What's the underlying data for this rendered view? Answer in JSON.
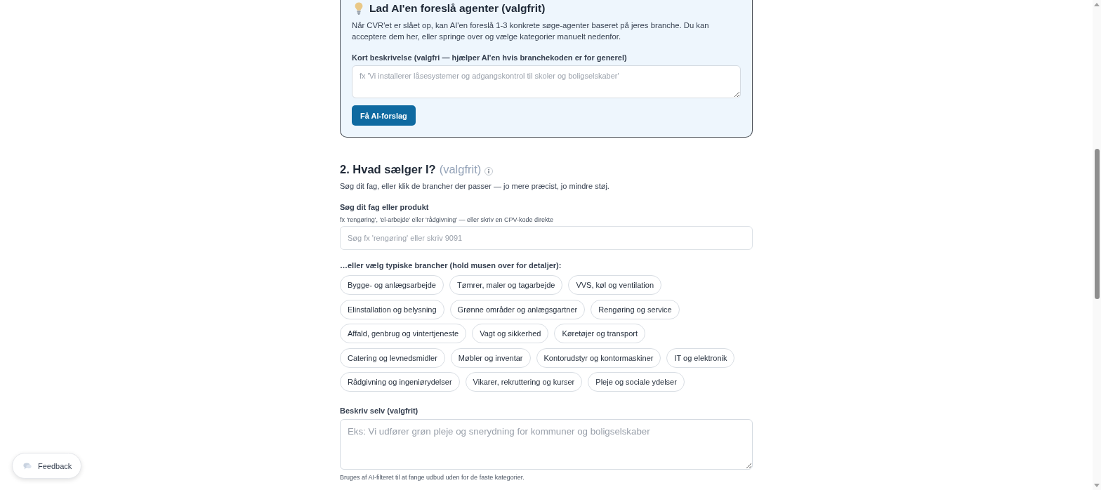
{
  "ai_card": {
    "title": "Lad AI'en foreslå agenter (valgfrit)",
    "description": "Når CVR'et er slået op, kan AI'en foreslå 1-3 konkrete søge-agenter baseret på jeres branche. Du kan acceptere dem her, eller springe over og vælge kategorier manuelt nedenfor.",
    "field": {
      "label": "Kort beskrivelse (valgfri — hjælper AI'en hvis branchekoden er for generel)",
      "placeholder": "fx 'Vi installerer låsesystemer og adgangskontrol til skoler og boligselskaber'"
    },
    "button": "Få AI-forslag"
  },
  "section": {
    "title": "2. Hvad sælger I?",
    "optional": "(valgfrit)",
    "subtitle": "Søg dit fag, eller klik de brancher der passer — jo mere præcist, jo mindre støj.",
    "search": {
      "label": "Søg dit fag eller produkt",
      "hint": "fx 'rengøring', 'el-arbejde' eller 'rådgivning' — eller skriv en CPV-kode direkte",
      "placeholder": "Søg fx 'rengøring' eller skriv 9091"
    },
    "chips_label": "…eller vælg typiske brancher (hold musen over for detaljer):",
    "chips": [
      {
        "label": "Bygge- og anlægsarbejde",
        "selected": false
      },
      {
        "label": "Tømrer, maler og tagarbejde",
        "selected": false
      },
      {
        "label": "VVS, køl og ventilation",
        "selected": false
      },
      {
        "label": "Elinstallation og belysning",
        "selected": false
      },
      {
        "label": "Grønne områder og anlægsgartner",
        "selected": false
      },
      {
        "label": "Rengøring og service",
        "selected": false
      },
      {
        "label": "Affald, genbrug og vintertjeneste",
        "selected": false
      },
      {
        "label": "Vagt og sikkerhed",
        "selected": false
      },
      {
        "label": "Køretøjer og transport",
        "selected": false
      },
      {
        "label": "Catering og levnedsmidler",
        "selected": false
      },
      {
        "label": "Møbler og inventar",
        "selected": false
      },
      {
        "label": "Kontorudstyr og kontormaskiner",
        "selected": false
      },
      {
        "label": "IT og elektronik",
        "selected": false
      },
      {
        "label": "Rådgivning og ingeniørydelser",
        "selected": false
      },
      {
        "label": "Vikarer, rekruttering og kurser",
        "selected": false
      },
      {
        "label": "Pleje og sociale ydelser",
        "selected": false
      }
    ],
    "custom": {
      "label": "Beskriv selv (valgfrit)",
      "placeholder": "Eks: Vi udfører grøn pleje og snerydning for kommuner og boligselskaber",
      "hint": "Bruges af AI-filteret til at fange udbud uden for de faste kategorier."
    }
  },
  "feedback_button": "Feedback"
}
